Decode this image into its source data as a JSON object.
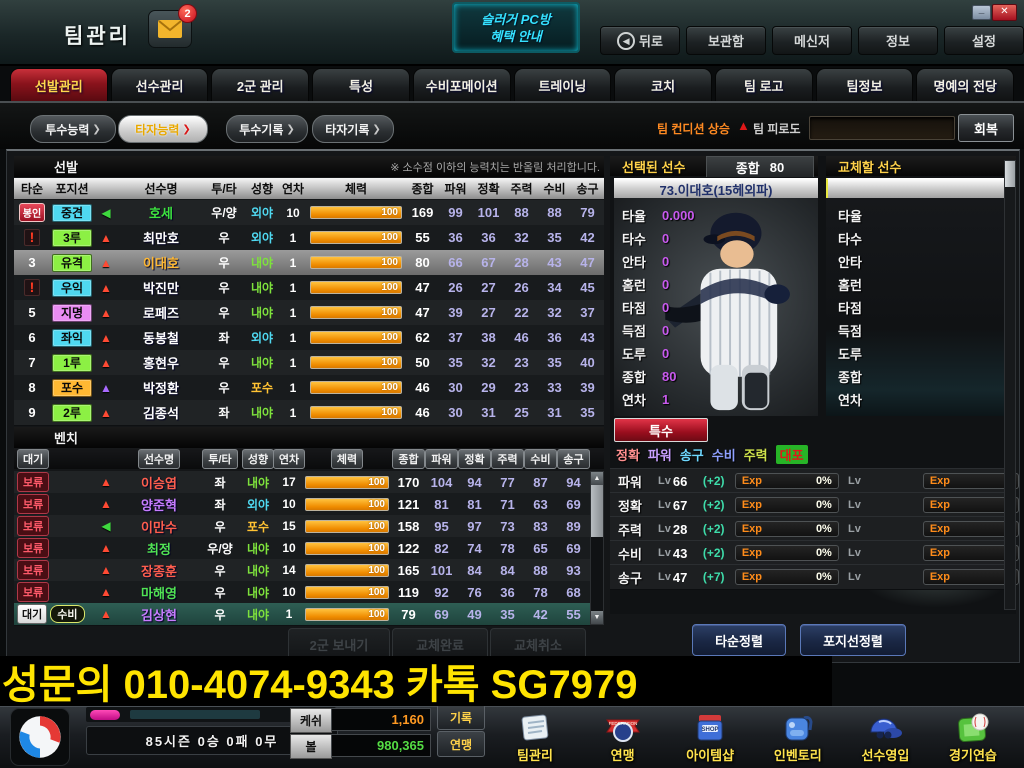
{
  "window": {
    "title": "팀관리",
    "mail_badge": "2",
    "minimize": "_",
    "close": "✕"
  },
  "pcbang": {
    "line1": "슬러거 PC방",
    "line2": "혜택 안내"
  },
  "nav": [
    "뒤로",
    "보관함",
    "메신저",
    "정보",
    "설정"
  ],
  "tabs": [
    {
      "label": "선발관리",
      "active": true
    },
    {
      "label": "선수관리"
    },
    {
      "label": "2군 관리"
    },
    {
      "label": "특성"
    },
    {
      "label": "수비포메이션"
    },
    {
      "label": "트레이닝"
    },
    {
      "label": "코치"
    },
    {
      "label": "팀 로고"
    },
    {
      "label": "팀정보"
    },
    {
      "label": "명예의 전당"
    }
  ],
  "subtab_arrow": "❯",
  "subtabs": [
    {
      "label": "투수능력"
    },
    {
      "label": "타자능력",
      "active": true
    },
    {
      "label": "투수기록"
    },
    {
      "label": "타자기록"
    }
  ],
  "condition": {
    "rise": "팀 컨디션 상승",
    "arrow": "▲",
    "fatigue": "팀 피로도",
    "recover": "회복"
  },
  "starter": {
    "title": "선발",
    "note": "※ 소수점 이하의 능력치는 반올림 처리합니다.",
    "columns": [
      "타순",
      "포지션",
      "선수명",
      "투/타",
      "성향",
      "연차",
      "체력",
      "종합",
      "파워",
      "정확",
      "주력",
      "수비",
      "송구"
    ],
    "rows": [
      {
        "order": "봉인",
        "order_style": "seal",
        "pos": "중견",
        "pos_color": "#4fd8f0",
        "arrow": "◀",
        "arrow_color": "#3ed83e",
        "name": "호세",
        "name_color": "#3ee43e",
        "hand": "우/양",
        "apt": "외야",
        "apt_color": "#4fd8f0",
        "years": "10",
        "stamina": "100",
        "stats": [
          "169",
          "99",
          "101",
          "88",
          "88",
          "79"
        ]
      },
      {
        "order": "!",
        "order_style": "alert",
        "pos": "3루",
        "pos_color": "#8cf044",
        "arrow": "▲",
        "arrow_color": "#ff4a33",
        "name": "최만호",
        "name_color": "#ffffff",
        "hand": "우",
        "apt": "외야",
        "apt_color": "#4fd8f0",
        "years": "1",
        "stamina": "100",
        "stats": [
          "55",
          "36",
          "36",
          "32",
          "35",
          "42"
        ]
      },
      {
        "order": "3",
        "order_style": "num",
        "pos": "유격",
        "pos_color": "#8cf044",
        "arrow": "▲",
        "arrow_color": "#ff4a33",
        "name": "이대호",
        "name_color": "#ffb833",
        "hand": "우",
        "apt": "내야",
        "apt_color": "#7ee23c",
        "years": "1",
        "stamina": "100",
        "stats": [
          "80",
          "66",
          "67",
          "28",
          "43",
          "47"
        ],
        "selected": true
      },
      {
        "order": "!",
        "order_style": "alert",
        "pos": "우익",
        "pos_color": "#4fd8f0",
        "arrow": "▲",
        "arrow_color": "#ff4a33",
        "name": "박진만",
        "name_color": "#ffffff",
        "hand": "우",
        "apt": "내야",
        "apt_color": "#7ee23c",
        "years": "1",
        "stamina": "100",
        "stats": [
          "47",
          "26",
          "27",
          "26",
          "34",
          "45"
        ]
      },
      {
        "order": "5",
        "order_style": "num",
        "pos": "지명",
        "pos_color": "#e98cf2",
        "arrow": "▲",
        "arrow_color": "#ff4a33",
        "name": "로페즈",
        "name_color": "#ffffff",
        "hand": "우",
        "apt": "내야",
        "apt_color": "#7ee23c",
        "years": "1",
        "stamina": "100",
        "stats": [
          "47",
          "39",
          "27",
          "22",
          "32",
          "37"
        ]
      },
      {
        "order": "6",
        "order_style": "num",
        "pos": "좌익",
        "pos_color": "#4fd8f0",
        "arrow": "▲",
        "arrow_color": "#ff4a33",
        "name": "동봉철",
        "name_color": "#ffffff",
        "hand": "좌",
        "apt": "외야",
        "apt_color": "#4fd8f0",
        "years": "1",
        "stamina": "100",
        "stats": [
          "62",
          "37",
          "38",
          "46",
          "36",
          "43"
        ]
      },
      {
        "order": "7",
        "order_style": "num",
        "pos": "1루",
        "pos_color": "#8cf044",
        "arrow": "▲",
        "arrow_color": "#ff4a33",
        "name": "홍현우",
        "name_color": "#ffffff",
        "hand": "우",
        "apt": "내야",
        "apt_color": "#7ee23c",
        "years": "1",
        "stamina": "100",
        "stats": [
          "50",
          "35",
          "32",
          "23",
          "35",
          "40"
        ]
      },
      {
        "order": "8",
        "order_style": "num",
        "pos": "포수",
        "pos_color": "#ffb833",
        "arrow": "▲",
        "arrow_color": "#a86aff",
        "name": "박정환",
        "name_color": "#ffffff",
        "hand": "우",
        "apt": "포수",
        "apt_color": "#ffc233",
        "years": "1",
        "stamina": "100",
        "stats": [
          "46",
          "30",
          "29",
          "23",
          "33",
          "39"
        ]
      },
      {
        "order": "9",
        "order_style": "num",
        "pos": "2루",
        "pos_color": "#8cf044",
        "arrow": "▲",
        "arrow_color": "#ff4a33",
        "name": "김종석",
        "name_color": "#ffffff",
        "hand": "좌",
        "apt": "내야",
        "apt_color": "#7ee23c",
        "years": "1",
        "stamina": "100",
        "stats": [
          "46",
          "30",
          "31",
          "25",
          "31",
          "35"
        ]
      }
    ]
  },
  "bench": {
    "title": "벤치",
    "columns": [
      "대기",
      "선수명",
      "투/타",
      "성향",
      "연차",
      "체력",
      "종합",
      "파워",
      "정확",
      "주력",
      "수비",
      "송구"
    ],
    "rows": [
      {
        "status": "보류",
        "status_style": "hold",
        "arrow": "▲",
        "arrow_color": "#ff4a33",
        "name": "이승엽",
        "name_color": "#ff5f4d",
        "hand": "좌",
        "apt": "내야",
        "apt_color": "#7ee23c",
        "years": "17",
        "stamina": "100",
        "stats": [
          "170",
          "104",
          "94",
          "77",
          "87",
          "94"
        ]
      },
      {
        "status": "보류",
        "status_style": "hold",
        "arrow": "▲",
        "arrow_color": "#ff4a33",
        "name": "양준혁",
        "name_color": "#c77dff",
        "hand": "좌",
        "apt": "외야",
        "apt_color": "#4fd8f0",
        "years": "10",
        "stamina": "100",
        "stats": [
          "121",
          "81",
          "81",
          "71",
          "63",
          "69"
        ]
      },
      {
        "status": "보류",
        "status_style": "hold",
        "arrow": "◀",
        "arrow_color": "#3ed83e",
        "name": "이만수",
        "name_color": "#ff5f4d",
        "hand": "우",
        "apt": "포수",
        "apt_color": "#ffc233",
        "years": "15",
        "stamina": "100",
        "stats": [
          "158",
          "95",
          "97",
          "73",
          "83",
          "89"
        ]
      },
      {
        "status": "보류",
        "status_style": "hold",
        "arrow": "▲",
        "arrow_color": "#ff4a33",
        "name": "최정",
        "name_color": "#52e452",
        "hand": "우/양",
        "apt": "내야",
        "apt_color": "#7ee23c",
        "years": "10",
        "stamina": "100",
        "stats": [
          "122",
          "82",
          "74",
          "78",
          "65",
          "69"
        ]
      },
      {
        "status": "보류",
        "status_style": "hold",
        "arrow": "▲",
        "arrow_color": "#ff4a33",
        "name": "장종훈",
        "name_color": "#ff5f4d",
        "hand": "우",
        "apt": "내야",
        "apt_color": "#7ee23c",
        "years": "14",
        "stamina": "100",
        "stats": [
          "165",
          "101",
          "84",
          "84",
          "88",
          "93"
        ]
      },
      {
        "status": "보류",
        "status_style": "hold",
        "arrow": "▲",
        "arrow_color": "#ff4a33",
        "name": "마해영",
        "name_color": "#52e452",
        "hand": "우",
        "apt": "내야",
        "apt_color": "#7ee23c",
        "years": "10",
        "stamina": "100",
        "stats": [
          "119",
          "92",
          "76",
          "36",
          "78",
          "68"
        ]
      },
      {
        "status": "대기",
        "status_style": "wait",
        "extra": "수비",
        "arrow": "▲",
        "arrow_color": "#ff4a33",
        "name": "김상현",
        "name_color": "#c77dff",
        "hand": "우",
        "apt": "내야",
        "apt_color": "#7ee23c",
        "years": "1",
        "stamina": "100",
        "stats": [
          "79",
          "69",
          "49",
          "35",
          "42",
          "55"
        ],
        "selected": true
      }
    ]
  },
  "actions": {
    "send_minor": "2군 보내기",
    "swap_done": "교체완료",
    "swap_cancel": "교체취소",
    "sort_order": "타순정렬",
    "sort_position": "포지선정렬"
  },
  "selected": {
    "header": "선택된 선수",
    "total_label": "종합",
    "total_value": "80",
    "name": "73.이대호(15헤외파)",
    "special": "특수",
    "stats": [
      {
        "label": "타율",
        "value": "0.000"
      },
      {
        "label": "타수",
        "value": "0"
      },
      {
        "label": "안타",
        "value": "0"
      },
      {
        "label": "홈런",
        "value": "0"
      },
      {
        "label": "타점",
        "value": "0"
      },
      {
        "label": "득점",
        "value": "0"
      },
      {
        "label": "도루",
        "value": "0"
      },
      {
        "label": "종합",
        "value": "80"
      },
      {
        "label": "연차",
        "value": "1"
      }
    ],
    "tags": [
      {
        "text": "정확",
        "color": "#ff8f8f"
      },
      {
        "text": "파워",
        "color": "#c9a0ff"
      },
      {
        "text": "송구",
        "color": "#6fd8ff"
      },
      {
        "text": "수비",
        "color": "#8fa0ff"
      },
      {
        "text": "주력",
        "color": "#cfe24c"
      },
      {
        "text": "대포",
        "color": "#e01818",
        "bg": "#27b427"
      }
    ],
    "lv_label": "Lv",
    "exp_label": "Exp",
    "pct": "0%",
    "lv_rows": [
      {
        "label": "파워",
        "lv": "66",
        "plus": "(+2)"
      },
      {
        "label": "정확",
        "lv": "67",
        "plus": "(+2)"
      },
      {
        "label": "주력",
        "lv": "28",
        "plus": "(+2)"
      },
      {
        "label": "수비",
        "lv": "43",
        "plus": "(+2)"
      },
      {
        "label": "송구",
        "lv": "47",
        "plus": "(+7)"
      }
    ]
  },
  "replace": {
    "header": "교체할 선수",
    "stat_labels": [
      "타율",
      "타수",
      "안타",
      "홈런",
      "타점",
      "득점",
      "도루",
      "종합",
      "연차"
    ],
    "lv_label": "Lv",
    "exp_label": "Exp"
  },
  "footer": {
    "season": "85시즌 0승 0패 0무",
    "cash_label": "케쉬",
    "cash_value": "1,160",
    "ball_label": "볼",
    "ball_value": "980,365",
    "tab_top": "기록",
    "tab_bottom": "연맹",
    "shop_icon_text": "SHOP",
    "menu": [
      {
        "label": "팀관리",
        "icon": "team-manage-icon"
      },
      {
        "label": "연맹",
        "icon": "federation-icon"
      },
      {
        "label": "아이템샵",
        "icon": "item-shop-icon"
      },
      {
        "label": "인벤토리",
        "icon": "inventory-icon"
      },
      {
        "label": "선수영입",
        "icon": "recruit-icon"
      },
      {
        "label": "경기연습",
        "icon": "practice-icon"
      }
    ]
  },
  "banner": {
    "text": "성문의 010-4074-9343 카톡 SG7979"
  }
}
